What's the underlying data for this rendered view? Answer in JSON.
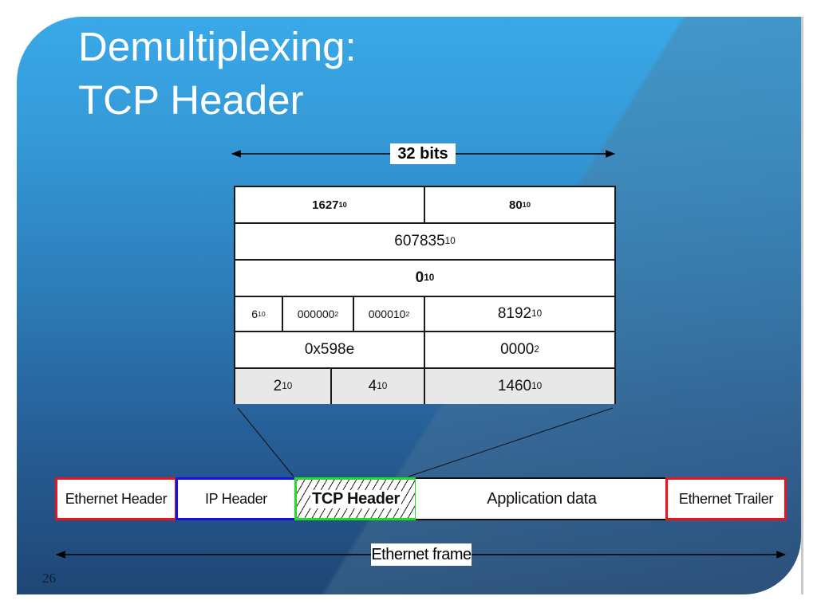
{
  "slide": {
    "title_lines": [
      "Demultiplexing:",
      "TCP Header"
    ],
    "page_number": "26",
    "colors": {
      "background_top": "#3aa9e8",
      "background_bottom": "#1f4675",
      "title_text": "#ffffff"
    }
  },
  "width_indicator": {
    "label": "32 bits"
  },
  "tcp_header_table": {
    "rows": [
      {
        "cells": [
          {
            "value": "1627",
            "base": "10",
            "bold": true
          },
          {
            "value": "80",
            "base": "10",
            "bold": true
          }
        ]
      },
      {
        "cells": [
          {
            "value": "607835",
            "base": "10"
          }
        ]
      },
      {
        "cells": [
          {
            "value": "0",
            "base": "10",
            "bold": true
          }
        ]
      },
      {
        "cells": [
          {
            "value": "6",
            "base": "10"
          },
          {
            "value": "000000",
            "base": "2"
          },
          {
            "value": "000010",
            "base": "2"
          },
          {
            "value": "8192",
            "base": "10"
          }
        ]
      },
      {
        "cells": [
          {
            "value": "0x598e",
            "base": ""
          },
          {
            "value": "0000",
            "base": "2"
          }
        ]
      },
      {
        "cells": [
          {
            "value": "2",
            "base": "10"
          },
          {
            "value": "4",
            "base": "10"
          },
          {
            "value": "1460",
            "base": "10"
          }
        ]
      }
    ]
  },
  "ethernet_frame": {
    "segments": [
      {
        "label": "Ethernet Header",
        "border_color": "#e8141e"
      },
      {
        "label": "IP Header",
        "border_color": "#1410e0"
      },
      {
        "label": "TCP Header",
        "border_color": "#22dd22",
        "highlighted": true
      },
      {
        "label": "Application data",
        "border_color": "#111111"
      },
      {
        "label": "Ethernet Trailer",
        "border_color": "#e8141e"
      }
    ],
    "span_label": "Ethernet frame"
  }
}
